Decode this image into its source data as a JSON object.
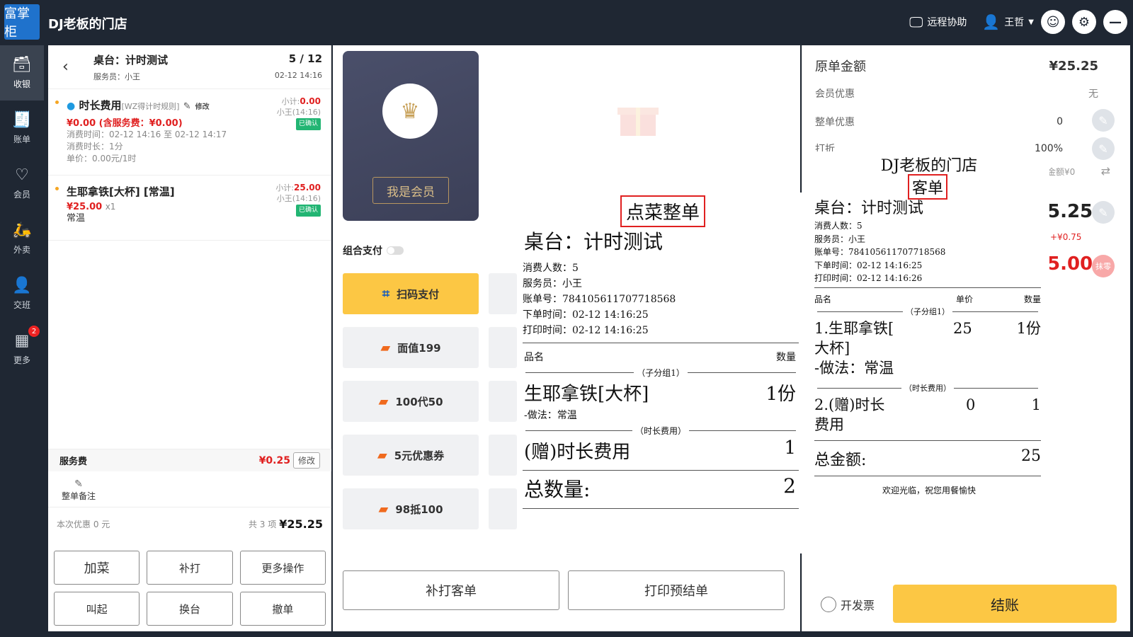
{
  "topbar": {
    "logo_text": "富掌柜",
    "store_name": "DJ老板的门店",
    "remote_help": "远程协助",
    "user_name": "王哲"
  },
  "sidebar": {
    "items": [
      {
        "label": "收银",
        "icon": "cash-register-icon"
      },
      {
        "label": "账单",
        "icon": "bill-icon"
      },
      {
        "label": "会员",
        "icon": "member-icon"
      },
      {
        "label": "外卖",
        "icon": "delivery-icon"
      },
      {
        "label": "交班",
        "icon": "shift-icon"
      },
      {
        "label": "更多",
        "icon": "grid-icon",
        "badge": "2"
      }
    ]
  },
  "order": {
    "table": "桌台：计时测试",
    "waiter": "服务员：小王",
    "page": "5 / 12",
    "time": "02-12 14:16",
    "items": [
      {
        "name": "时长费用",
        "rule": "[WZ得计时规则]",
        "edit": "修改",
        "price": "¥0.00 (含服务费：¥0.00)",
        "subtotal_label": "小计:",
        "subtotal": "0.00",
        "waiter_time": "小王(14:16)",
        "status": "已确认",
        "meta1": "消费时间：02-12 14:16 至 02-12 14:17",
        "meta2": "消费时长：1分",
        "meta3": "单价：0.00元/1时"
      },
      {
        "name": "生耶拿铁[大杯] [常温]",
        "price": "¥25.00",
        "qty": "x1",
        "subtotal_label": "小计:",
        "subtotal": "25.00",
        "waiter_time": "小王(14:16)",
        "status": "已确认",
        "note": "常温"
      }
    ],
    "service_fee_label": "服务费",
    "service_fee": "¥0.25",
    "service_edit": "修改",
    "remark": "整单备注",
    "discount_info": "本次优惠 0 元",
    "count_info": "共 3 项",
    "total": "¥25.25",
    "buttons": [
      "加菜",
      "补打",
      "更多操作",
      "叫起",
      "换台",
      "撤单"
    ]
  },
  "payment": {
    "member_button": "我是会员",
    "combo_pay": "组合支付",
    "methods": [
      "扫码支付",
      "面值199",
      "100代50",
      "5元优惠券",
      "98抵100"
    ],
    "reprint": "补打客单",
    "preprint": "打印预结单"
  },
  "receipt_a": {
    "title": "点菜整单",
    "table": "桌台：计时测试",
    "guests": "消费人数：5",
    "waiter": "服务员：小王",
    "bill_no": "账单号：784105611707718568",
    "order_time": "下单时间：02-12 14:16:25",
    "print_time": "打印时间：02-12 14:16:25",
    "col_name": "品名",
    "col_qty": "数量",
    "group1": "（子分组1）",
    "item1": "生耶拿铁[大杯]",
    "item1_qty": "1份",
    "item1_note": "-做法：常温",
    "group2": "（时长费用）",
    "item2": "(赠)时长费用",
    "item2_qty": "1",
    "total_label": "总数量:",
    "total_val": "2"
  },
  "receipt_b": {
    "store": "DJ老板的门店",
    "title": "客单",
    "table": "桌台：计时测试",
    "guests": "消费人数：5",
    "waiter": "服务员：小王",
    "bill_no": "账单号：784105611707718568",
    "order_time": "下单时间：02-12 14:16:25",
    "print_time": "打印时间：02-12 14:16:26",
    "col_name": "品名",
    "col_price": "单价",
    "col_qty": "数量",
    "group1": "（子分组1）",
    "item1_line1": "1.生耶拿铁[",
    "item1_line2": "大杯]",
    "item1_price": "25",
    "item1_qty": "1份",
    "item1_note": "-做法：常温",
    "group2": "（时长费用）",
    "item2_line1": "2.(赠)时长",
    "item2_line2": "费用",
    "item2_price": "0",
    "item2_qty": "1",
    "total_label": "总金额:",
    "total_val": "25",
    "footer": "欢迎光临，祝您用餐愉快"
  },
  "summary_panel": {
    "original_label": "原单金额",
    "original_val": "¥25.25",
    "member_label": "会员优惠",
    "member_val": "无",
    "order_discount_label": "整单优惠",
    "order_discount_val": "0",
    "discount_label": "打折",
    "discount_val": "100%",
    "fragment_amount": "金额¥0",
    "fragment_due": "5.25",
    "fragment_diff": "+¥0.75",
    "fragment_paid": "5.00",
    "round_button": "抹零",
    "invoice": "开发票",
    "checkout": "结账"
  }
}
